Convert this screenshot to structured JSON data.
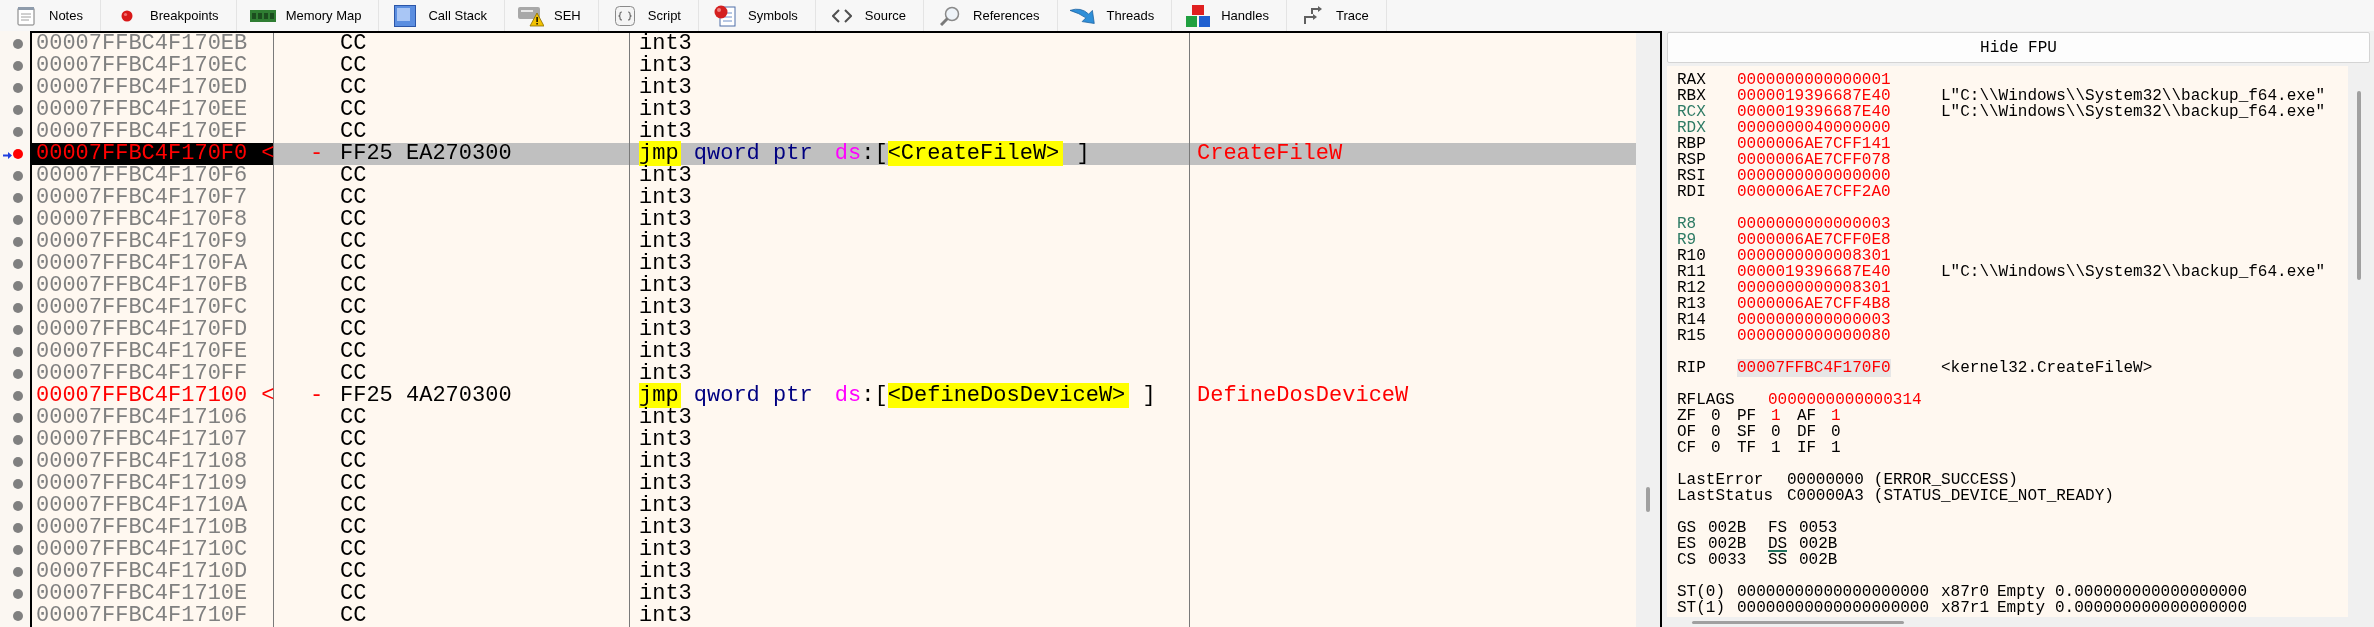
{
  "toolbar": {
    "tabs": [
      {
        "label": "Notes"
      },
      {
        "label": "Breakpoints"
      },
      {
        "label": "Memory Map"
      },
      {
        "label": "Call Stack"
      },
      {
        "label": "SEH"
      },
      {
        "label": "Script"
      },
      {
        "label": "Symbols"
      },
      {
        "label": "Source"
      },
      {
        "label": "References"
      },
      {
        "label": "Threads"
      },
      {
        "label": "Handles"
      },
      {
        "label": "Trace"
      }
    ]
  },
  "disassembly": {
    "rows": [
      {
        "address": "00007FFBC4F170EB",
        "bytes": "CC",
        "instruction": [
          {
            "kind": "mnemonic",
            "text": "int3"
          }
        ],
        "selected": false,
        "rip": false,
        "breakpoint": false
      },
      {
        "address": "00007FFBC4F170EC",
        "bytes": "CC",
        "instruction": [
          {
            "kind": "mnemonic",
            "text": "int3"
          }
        ],
        "selected": false,
        "rip": false,
        "breakpoint": false
      },
      {
        "address": "00007FFBC4F170ED",
        "bytes": "CC",
        "instruction": [
          {
            "kind": "mnemonic",
            "text": "int3"
          }
        ],
        "selected": false,
        "rip": false,
        "breakpoint": false
      },
      {
        "address": "00007FFBC4F170EE",
        "bytes": "CC",
        "instruction": [
          {
            "kind": "mnemonic",
            "text": "int3"
          }
        ],
        "selected": false,
        "rip": false,
        "breakpoint": false
      },
      {
        "address": "00007FFBC4F170EF",
        "bytes": "CC",
        "instruction": [
          {
            "kind": "mnemonic",
            "text": "int3"
          }
        ],
        "selected": false,
        "rip": false,
        "breakpoint": false
      },
      {
        "address": "00007FFBC4F170F0",
        "address_marker": "<",
        "bytes_marker": "-",
        "bytes": "FF25 EA270300",
        "instruction": [
          {
            "kind": "jump",
            "text": "jmp"
          },
          {
            "kind": "size",
            "text": "qword ptr"
          },
          {
            "kind": "segment",
            "text": "ds"
          },
          {
            "kind": "bracket_open",
            "text": ":["
          },
          {
            "kind": "symbol",
            "text": "<CreateFileW>"
          },
          {
            "kind": "bracket_close",
            "text": "]"
          }
        ],
        "comment": "CreateFileW",
        "selected": true,
        "rip": true,
        "breakpoint": true
      },
      {
        "address": "00007FFBC4F170F6",
        "bytes": "CC",
        "instruction": [
          {
            "kind": "mnemonic",
            "text": "int3"
          }
        ],
        "selected": false,
        "rip": false,
        "breakpoint": false
      },
      {
        "address": "00007FFBC4F170F7",
        "bytes": "CC",
        "instruction": [
          {
            "kind": "mnemonic",
            "text": "int3"
          }
        ],
        "selected": false,
        "rip": false,
        "breakpoint": false
      },
      {
        "address": "00007FFBC4F170F8",
        "bytes": "CC",
        "instruction": [
          {
            "kind": "mnemonic",
            "text": "int3"
          }
        ],
        "selected": false,
        "rip": false,
        "breakpoint": false
      },
      {
        "address": "00007FFBC4F170F9",
        "bytes": "CC",
        "instruction": [
          {
            "kind": "mnemonic",
            "text": "int3"
          }
        ],
        "selected": false,
        "rip": false,
        "breakpoint": false
      },
      {
        "address": "00007FFBC4F170FA",
        "bytes": "CC",
        "instruction": [
          {
            "kind": "mnemonic",
            "text": "int3"
          }
        ],
        "selected": false,
        "rip": false,
        "breakpoint": false
      },
      {
        "address": "00007FFBC4F170FB",
        "bytes": "CC",
        "instruction": [
          {
            "kind": "mnemonic",
            "text": "int3"
          }
        ],
        "selected": false,
        "rip": false,
        "breakpoint": false
      },
      {
        "address": "00007FFBC4F170FC",
        "bytes": "CC",
        "instruction": [
          {
            "kind": "mnemonic",
            "text": "int3"
          }
        ],
        "selected": false,
        "rip": false,
        "breakpoint": false
      },
      {
        "address": "00007FFBC4F170FD",
        "bytes": "CC",
        "instruction": [
          {
            "kind": "mnemonic",
            "text": "int3"
          }
        ],
        "selected": false,
        "rip": false,
        "breakpoint": false
      },
      {
        "address": "00007FFBC4F170FE",
        "bytes": "CC",
        "instruction": [
          {
            "kind": "mnemonic",
            "text": "int3"
          }
        ],
        "selected": false,
        "rip": false,
        "breakpoint": false
      },
      {
        "address": "00007FFBC4F170FF",
        "bytes": "CC",
        "instruction": [
          {
            "kind": "mnemonic",
            "text": "int3"
          }
        ],
        "selected": false,
        "rip": false,
        "breakpoint": false
      },
      {
        "address": "00007FFBC4F17100",
        "address_marker": "<",
        "bytes_marker": "-",
        "bytes": "FF25 4A270300",
        "instruction": [
          {
            "kind": "jump",
            "text": "jmp"
          },
          {
            "kind": "size",
            "text": "qword ptr"
          },
          {
            "kind": "segment",
            "text": "ds"
          },
          {
            "kind": "bracket_open",
            "text": ":["
          },
          {
            "kind": "symbol",
            "text": "<DefineDosDeviceW>"
          },
          {
            "kind": "bracket_close",
            "text": "]"
          }
        ],
        "comment": "DefineDosDeviceW",
        "selected": false,
        "rip": false,
        "breakpoint": true
      },
      {
        "address": "00007FFBC4F17106",
        "bytes": "CC",
        "instruction": [
          {
            "kind": "mnemonic",
            "text": "int3"
          }
        ],
        "selected": false,
        "rip": false,
        "breakpoint": false
      },
      {
        "address": "00007FFBC4F17107",
        "bytes": "CC",
        "instruction": [
          {
            "kind": "mnemonic",
            "text": "int3"
          }
        ],
        "selected": false,
        "rip": false,
        "breakpoint": false
      },
      {
        "address": "00007FFBC4F17108",
        "bytes": "CC",
        "instruction": [
          {
            "kind": "mnemonic",
            "text": "int3"
          }
        ],
        "selected": false,
        "rip": false,
        "breakpoint": false
      },
      {
        "address": "00007FFBC4F17109",
        "bytes": "CC",
        "instruction": [
          {
            "kind": "mnemonic",
            "text": "int3"
          }
        ],
        "selected": false,
        "rip": false,
        "breakpoint": false
      },
      {
        "address": "00007FFBC4F1710A",
        "bytes": "CC",
        "instruction": [
          {
            "kind": "mnemonic",
            "text": "int3"
          }
        ],
        "selected": false,
        "rip": false,
        "breakpoint": false
      },
      {
        "address": "00007FFBC4F1710B",
        "bytes": "CC",
        "instruction": [
          {
            "kind": "mnemonic",
            "text": "int3"
          }
        ],
        "selected": false,
        "rip": false,
        "breakpoint": false
      },
      {
        "address": "00007FFBC4F1710C",
        "bytes": "CC",
        "instruction": [
          {
            "kind": "mnemonic",
            "text": "int3"
          }
        ],
        "selected": false,
        "rip": false,
        "breakpoint": false
      },
      {
        "address": "00007FFBC4F1710D",
        "bytes": "CC",
        "instruction": [
          {
            "kind": "mnemonic",
            "text": "int3"
          }
        ],
        "selected": false,
        "rip": false,
        "breakpoint": false
      },
      {
        "address": "00007FFBC4F1710E",
        "bytes": "CC",
        "instruction": [
          {
            "kind": "mnemonic",
            "text": "int3"
          }
        ],
        "selected": false,
        "rip": false,
        "breakpoint": false
      },
      {
        "address": "00007FFBC4F1710F",
        "bytes": "CC",
        "instruction": [
          {
            "kind": "mnemonic",
            "text": "int3"
          }
        ],
        "selected": false,
        "rip": false,
        "breakpoint": false
      }
    ]
  },
  "fpu_toggle": {
    "label": "Hide FPU"
  },
  "registers": {
    "general": [
      {
        "name": "RAX",
        "value": "0000000000000001",
        "changed": true,
        "argument": false
      },
      {
        "name": "RBX",
        "value": "0000019396687E40",
        "comment": "L\"C:\\\\Windows\\\\System32\\\\backup_f64.exe\"",
        "changed": true,
        "argument": false
      },
      {
        "name": "RCX",
        "value": "0000019396687E40",
        "comment": "L\"C:\\\\Windows\\\\System32\\\\backup_f64.exe\"",
        "changed": true,
        "argument": true
      },
      {
        "name": "RDX",
        "value": "0000000040000000",
        "changed": true,
        "argument": true
      },
      {
        "name": "RBP",
        "value": "0000006AE7CFF141",
        "changed": true,
        "argument": false
      },
      {
        "name": "RSP",
        "value": "0000006AE7CFF078",
        "changed": true,
        "argument": false
      },
      {
        "name": "RSI",
        "value": "0000000000000000",
        "changed": true,
        "argument": false
      },
      {
        "name": "RDI",
        "value": "0000006AE7CFF2A0",
        "changed": true,
        "argument": false
      }
    ],
    "extended": [
      {
        "name": "R8",
        "value": "0000000000000003",
        "changed": true,
        "argument": true
      },
      {
        "name": "R9",
        "value": "0000006AE7CFF0E8",
        "changed": true,
        "argument": true
      },
      {
        "name": "R10",
        "value": "0000000000008301",
        "changed": true,
        "argument": false
      },
      {
        "name": "R11",
        "value": "0000019396687E40",
        "comment": "L\"C:\\\\Windows\\\\System32\\\\backup_f64.exe\"",
        "changed": true,
        "argument": false
      },
      {
        "name": "R12",
        "value": "0000000000008301",
        "changed": true,
        "argument": false
      },
      {
        "name": "R13",
        "value": "0000006AE7CFF4B8",
        "changed": true,
        "argument": false
      },
      {
        "name": "R14",
        "value": "0000000000000003",
        "changed": true,
        "argument": false
      },
      {
        "name": "R15",
        "value": "0000000000000080",
        "changed": true,
        "argument": false
      }
    ],
    "instruction_pointer": {
      "name": "RIP",
      "value": "00007FFBC4F170F0",
      "comment": "<kernel32.CreateFileW>",
      "changed": true,
      "highlighted": true
    },
    "flags": {
      "name": "RFLAGS",
      "value": "0000000000000314",
      "changed": true,
      "items": [
        {
          "name": "ZF",
          "value": "0",
          "changed": false
        },
        {
          "name": "PF",
          "value": "1",
          "changed": true
        },
        {
          "name": "AF",
          "value": "1",
          "changed": true
        },
        {
          "name": "OF",
          "value": "0",
          "changed": false
        },
        {
          "name": "SF",
          "value": "0",
          "changed": false
        },
        {
          "name": "DF",
          "value": "0",
          "changed": false
        },
        {
          "name": "CF",
          "value": "0",
          "changed": false
        },
        {
          "name": "TF",
          "value": "1",
          "changed": false
        },
        {
          "name": "IF",
          "value": "1",
          "changed": false
        }
      ]
    },
    "last_error": {
      "label": "LastError",
      "value": "00000000",
      "description": "(ERROR_SUCCESS)"
    },
    "last_status": {
      "label": "LastStatus",
      "value": "C00000A3",
      "description": "(STATUS_DEVICE_NOT_READY)"
    },
    "segments": [
      {
        "name": "GS",
        "value": "002B",
        "focused": false
      },
      {
        "name": "FS",
        "value": "0053",
        "focused": false
      },
      {
        "name": "ES",
        "value": "002B",
        "focused": false
      },
      {
        "name": "DS",
        "value": "002B",
        "focused": true
      },
      {
        "name": "CS",
        "value": "0033",
        "focused": false
      },
      {
        "name": "SS",
        "value": "002B",
        "focused": false
      }
    ],
    "fpu": [
      {
        "name": "ST(0)",
        "value": "00000000000000000000",
        "tag_register": "x87r0",
        "tag": "Empty",
        "float": "0.000000000000000000"
      },
      {
        "name": "ST(1)",
        "value": "00000000000000000000",
        "tag_register": "x87r1",
        "tag": "Empty",
        "float": "0.000000000000000000"
      }
    ]
  }
}
